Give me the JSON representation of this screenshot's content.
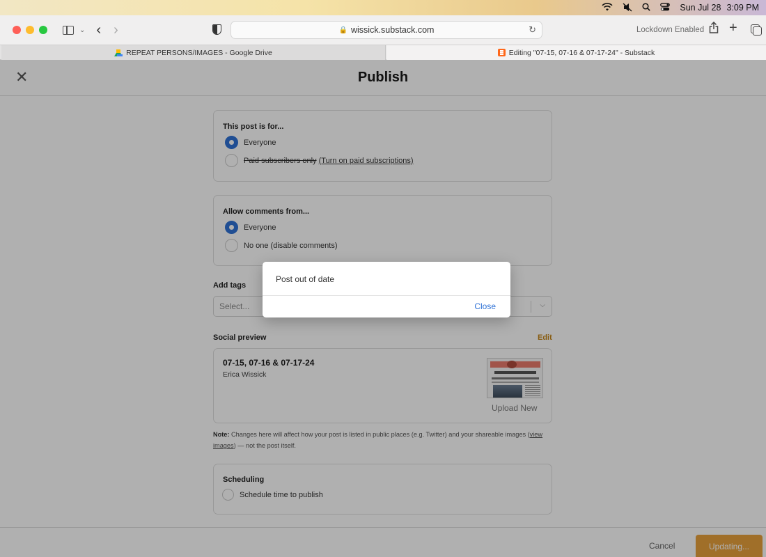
{
  "menubar": {
    "date": "Sun Jul 28",
    "time": "3:09 PM",
    "icons": [
      "wifi-icon",
      "mute-icon",
      "search-icon",
      "control-center-icon"
    ]
  },
  "browser": {
    "url": "wissick.substack.com",
    "lockdown_label": "Lockdown Enabled",
    "tabs": [
      {
        "label": "REPEAT PERSONS/IMAGES - Google Drive"
      },
      {
        "label": "Editing \"07-15, 07-16 & 07-17-24\" - Substack"
      }
    ]
  },
  "page": {
    "title": "Publish",
    "audience": {
      "title": "This post is for...",
      "option_everyone": "Everyone",
      "option_paid": "Paid subscribers only",
      "paid_link": "(Turn on paid subscriptions)"
    },
    "comments": {
      "title": "Allow comments from...",
      "option_everyone": "Everyone",
      "option_none": "No one (disable comments)"
    },
    "tags": {
      "label": "Add tags",
      "placeholder": "Select..."
    },
    "social_preview": {
      "label": "Social preview",
      "edit_label": "Edit",
      "post_title": "07-15, 07-16 & 07-17-24",
      "author": "Erica Wissick",
      "upload_label": "Upload New"
    },
    "note": {
      "bold": "Note:",
      "text_before": " Changes here will affect how your post is listed in public places (e.g. Twitter) and your shareable images (",
      "link": "view images",
      "text_after": ") — not the post itself."
    },
    "scheduling": {
      "title": "Scheduling",
      "option": "Schedule time to publish"
    },
    "footer": {
      "cancel_label": "Cancel",
      "updating_label": "Updating..."
    }
  },
  "dialog": {
    "message": "Post out of date",
    "close_label": "Close"
  },
  "colors": {
    "accent_blue": "#2f72d6",
    "brand_orange": "#e8a13c",
    "edit_link": "#c4861a"
  }
}
